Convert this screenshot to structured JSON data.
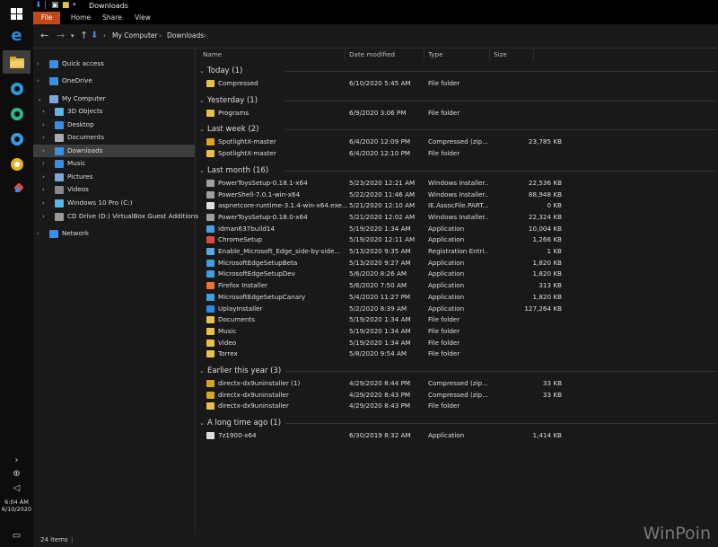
{
  "window": {
    "title": "Downloads"
  },
  "ribbon": {
    "tabs": [
      "File",
      "Home",
      "Share",
      "View"
    ]
  },
  "address": {
    "crumbs": [
      "My Computer",
      "Downloads"
    ]
  },
  "clock": {
    "time": "6:04 AM",
    "date": "6/10/2020"
  },
  "nav": {
    "items": [
      {
        "label": "Quick access",
        "icon": "star-icon",
        "color": "#3a8ee6"
      },
      {
        "label": "OneDrive",
        "icon": "cloud-icon",
        "color": "#3a8ee6"
      },
      {
        "label": "My Computer",
        "icon": "computer-icon",
        "color": "#7aa7d8"
      },
      {
        "label": "3D Objects",
        "icon": "cube-icon",
        "color": "#5ab4e8"
      },
      {
        "label": "Desktop",
        "icon": "desktop-icon",
        "color": "#3a8ee6"
      },
      {
        "label": "Documents",
        "icon": "document-icon",
        "color": "#aaaaaa"
      },
      {
        "label": "Downloads",
        "icon": "download-icon",
        "color": "#3a8ee6"
      },
      {
        "label": "Music",
        "icon": "music-icon",
        "color": "#3a8ee6"
      },
      {
        "label": "Pictures",
        "icon": "picture-icon",
        "color": "#7aa7d8"
      },
      {
        "label": "Videos",
        "icon": "video-icon",
        "color": "#888888"
      },
      {
        "label": "Windows 10 Pro (C:)",
        "icon": "drive-icon",
        "color": "#5ab4e8"
      },
      {
        "label": "CD Drive (D:) VirtualBox Guest Additions",
        "icon": "cd-drive-icon",
        "color": "#999999"
      },
      {
        "label": "Network",
        "icon": "network-icon",
        "color": "#3a8ee6"
      }
    ]
  },
  "columns": {
    "name": "Name",
    "date": "Date modified",
    "type": "Type",
    "size": "Size"
  },
  "groups": [
    {
      "label": "Today (1)",
      "files": [
        {
          "name": "Compressed",
          "date": "6/10/2020 5:45 AM",
          "type": "File folder",
          "size": "",
          "icon": "folder-icon",
          "color": "#e8c04a"
        }
      ]
    },
    {
      "label": "Yesterday (1)",
      "files": [
        {
          "name": "Programs",
          "date": "6/9/2020 3:06 PM",
          "type": "File folder",
          "size": "",
          "icon": "folder-icon",
          "color": "#e8c04a"
        }
      ]
    },
    {
      "label": "Last week (2)",
      "files": [
        {
          "name": "SpotlightX-master",
          "date": "6/4/2020 12:09 PM",
          "type": "Compressed (zip...",
          "size": "23,785 KB",
          "icon": "zip-icon",
          "color": "#d9a520"
        },
        {
          "name": "SpotlightX-master",
          "date": "6/4/2020 12:10 PM",
          "type": "File folder",
          "size": "",
          "icon": "folder-icon",
          "color": "#e8c04a"
        }
      ]
    },
    {
      "label": "Last month (16)",
      "files": [
        {
          "name": "PowerToysSetup-0.18.1-x64",
          "date": "5/23/2020 12:21 AM",
          "type": "Windows Installer...",
          "size": "22,536 KB",
          "icon": "installer-icon",
          "color": "#a0a0a0"
        },
        {
          "name": "PowerShell-7.0.1-win-x64",
          "date": "5/22/2020 11:46 AM",
          "type": "Windows Installer...",
          "size": "88,948 KB",
          "icon": "installer-icon",
          "color": "#a0a0a0"
        },
        {
          "name": "aspnetcore-runtime-3.1.4-win-x64.exe...",
          "date": "5/21/2020 12:10 AM",
          "type": "IE.AssocFile.PART...",
          "size": "0 KB",
          "icon": "file-icon",
          "color": "#e0e0e0"
        },
        {
          "name": "PowerToysSetup-0.18.0-x64",
          "date": "5/21/2020 12:02 AM",
          "type": "Windows Installer...",
          "size": "22,324 KB",
          "icon": "installer-icon",
          "color": "#a0a0a0"
        },
        {
          "name": "idman637build14",
          "date": "5/19/2020 1:34 AM",
          "type": "Application",
          "size": "10,004 KB",
          "icon": "app-icon",
          "color": "#4aa0e0"
        },
        {
          "name": "ChromeSetup",
          "date": "5/19/2020 12:11 AM",
          "type": "Application",
          "size": "1,266 KB",
          "icon": "chrome-icon",
          "color": "#e04a3a"
        },
        {
          "name": "Enable_Microsoft_Edge_side-by-side...",
          "date": "5/13/2020 9:35 AM",
          "type": "Registration Entri...",
          "size": "1 KB",
          "icon": "registry-icon",
          "color": "#5aa8e0"
        },
        {
          "name": "MicrosoftEdgeSetupBeta",
          "date": "5/13/2020 9:27 AM",
          "type": "Application",
          "size": "1,820 KB",
          "icon": "edge-icon",
          "color": "#3aa0e0"
        },
        {
          "name": "MicrosoftEdgeSetupDev",
          "date": "5/6/2020 8:26 AM",
          "type": "Application",
          "size": "1,820 KB",
          "icon": "edge-icon",
          "color": "#3aa0e0"
        },
        {
          "name": "Firefox Installer",
          "date": "5/6/2020 7:50 AM",
          "type": "Application",
          "size": "313 KB",
          "icon": "firefox-icon",
          "color": "#e8743a"
        },
        {
          "name": "MicrosoftEdgeSetupCanary",
          "date": "5/4/2020 11:27 PM",
          "type": "Application",
          "size": "1,820 KB",
          "icon": "edge-icon",
          "color": "#3aa0e0"
        },
        {
          "name": "UplayInstaller",
          "date": "5/2/2020 8:39 AM",
          "type": "Application",
          "size": "127,264 KB",
          "icon": "uplay-icon",
          "color": "#2a8ae0"
        },
        {
          "name": "Documents",
          "date": "5/19/2020 1:34 AM",
          "type": "File folder",
          "size": "",
          "icon": "folder-icon",
          "color": "#e8c04a"
        },
        {
          "name": "Music",
          "date": "5/19/2020 1:34 AM",
          "type": "File folder",
          "size": "",
          "icon": "folder-icon",
          "color": "#e8c04a"
        },
        {
          "name": "Video",
          "date": "5/19/2020 1:34 AM",
          "type": "File folder",
          "size": "",
          "icon": "folder-icon",
          "color": "#e8c04a"
        },
        {
          "name": "Torrex",
          "date": "5/8/2020 9:54 AM",
          "type": "File folder",
          "size": "",
          "icon": "folder-icon",
          "color": "#e8c04a"
        }
      ]
    },
    {
      "label": "Earlier this year (3)",
      "files": [
        {
          "name": "directx-dx9uninstaller (1)",
          "date": "4/29/2020 8:44 PM",
          "type": "Compressed (zip...",
          "size": "33 KB",
          "icon": "zip-icon",
          "color": "#d9a520"
        },
        {
          "name": "directx-dx9uninstaller",
          "date": "4/29/2020 8:43 PM",
          "type": "Compressed (zip...",
          "size": "33 KB",
          "icon": "zip-icon",
          "color": "#d9a520"
        },
        {
          "name": "directx-dx9uninstaller",
          "date": "4/29/2020 8:43 PM",
          "type": "File folder",
          "size": "",
          "icon": "folder-icon",
          "color": "#e8c04a"
        }
      ]
    },
    {
      "label": "A long time ago (1)",
      "files": [
        {
          "name": "7z1900-x64",
          "date": "6/30/2019 8:32 AM",
          "type": "Application",
          "size": "1,414 KB",
          "icon": "7zip-icon",
          "color": "#dddddd"
        }
      ]
    }
  ],
  "status": {
    "count": "24 items"
  },
  "watermark": "WinPoin"
}
